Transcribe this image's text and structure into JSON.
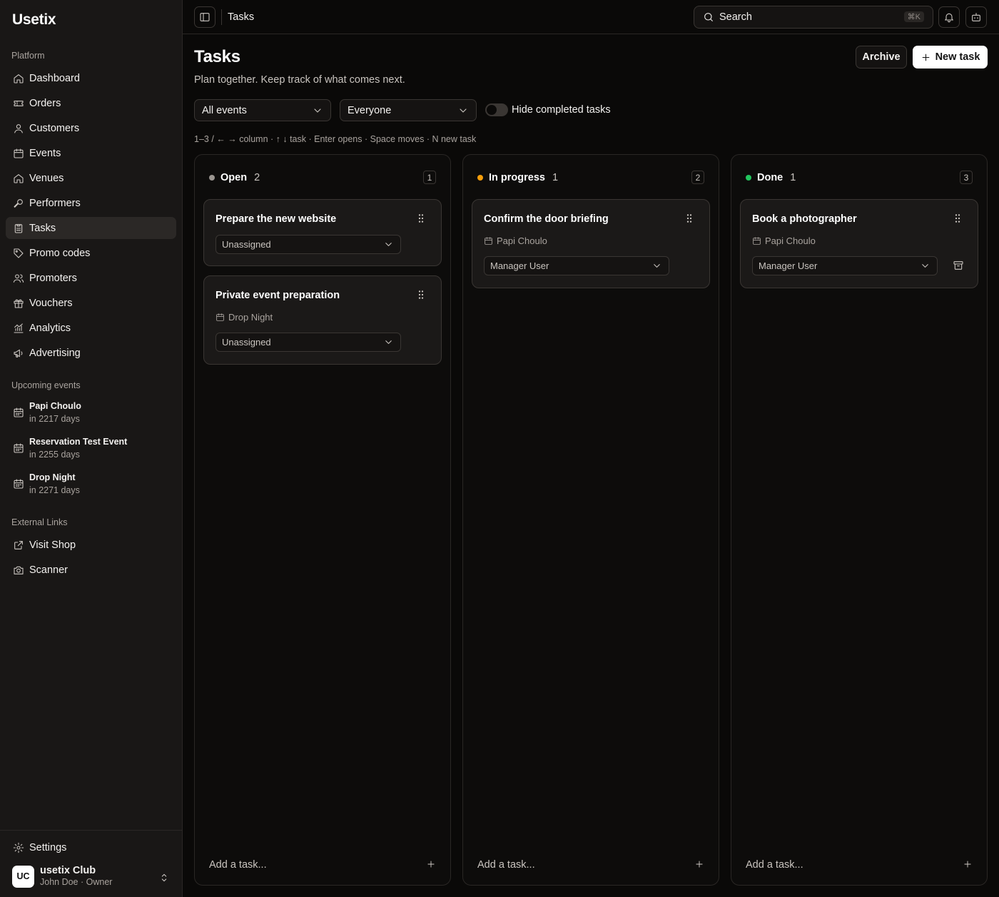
{
  "brand": "Usetix",
  "sidebar": {
    "platform_label": "Platform",
    "items": [
      {
        "label": "Dashboard",
        "icon": "home-icon"
      },
      {
        "label": "Orders",
        "icon": "ticket-icon"
      },
      {
        "label": "Customers",
        "icon": "user-icon"
      },
      {
        "label": "Events",
        "icon": "calendar-icon"
      },
      {
        "label": "Venues",
        "icon": "home-icon"
      },
      {
        "label": "Performers",
        "icon": "mic-icon"
      },
      {
        "label": "Tasks",
        "icon": "clipboard-icon",
        "active": true
      },
      {
        "label": "Promo codes",
        "icon": "tag-icon"
      },
      {
        "label": "Promoters",
        "icon": "users-icon"
      },
      {
        "label": "Vouchers",
        "icon": "gift-icon"
      },
      {
        "label": "Analytics",
        "icon": "chart-icon"
      },
      {
        "label": "Advertising",
        "icon": "megaphone-icon"
      }
    ],
    "upcoming_label": "Upcoming events",
    "upcoming": [
      {
        "name": "Papi Choulo",
        "when": "in 2217 days"
      },
      {
        "name": "Reservation Test Event",
        "when": "in 2255 days"
      },
      {
        "name": "Drop Night",
        "when": "in 2271 days"
      }
    ],
    "external_label": "External Links",
    "external": [
      {
        "label": "Visit Shop",
        "icon": "external-link-icon"
      },
      {
        "label": "Scanner",
        "icon": "camera-icon"
      }
    ],
    "settings_label": "Settings",
    "account": {
      "initials": "UC",
      "name": "usetix Club",
      "sub": "John Doe · Owner"
    }
  },
  "topbar": {
    "title": "Tasks",
    "search_label": "Search",
    "search_shortcut": "⌘K"
  },
  "header": {
    "title": "Tasks",
    "subtitle": "Plan together. Keep track of what comes next.",
    "archive_label": "Archive",
    "new_task_label": "New task"
  },
  "filters": {
    "event_select": "All events",
    "people_select": "Everyone",
    "hide_completed_label": "Hide completed tasks",
    "hide_completed": false
  },
  "hint": "1–3 / ← → column · ↑ ↓ task · Enter opens · Space moves · N new task",
  "colors": {
    "open": "#9a9590",
    "in_progress": "#f59e0b",
    "done": "#22c55e"
  },
  "columns": [
    {
      "name": "Open",
      "count": "2",
      "key": "1",
      "status": "open",
      "add_label": "Add a task...",
      "cards": [
        {
          "title": "Prepare the new website",
          "event": "",
          "assignee": "Unassigned"
        },
        {
          "title": "Private event preparation",
          "event": "Drop Night",
          "assignee": "Unassigned"
        }
      ]
    },
    {
      "name": "In progress",
      "count": "1",
      "key": "2",
      "status": "in_progress",
      "add_label": "Add a task...",
      "cards": [
        {
          "title": "Confirm the door briefing",
          "event": "Papi Choulo",
          "assignee": "Manager User"
        }
      ]
    },
    {
      "name": "Done",
      "count": "1",
      "key": "3",
      "status": "done",
      "add_label": "Add a task...",
      "cards": [
        {
          "title": "Book a photographer",
          "event": "Papi Choulo",
          "assignee": "Manager User",
          "archivable": true
        }
      ]
    }
  ]
}
